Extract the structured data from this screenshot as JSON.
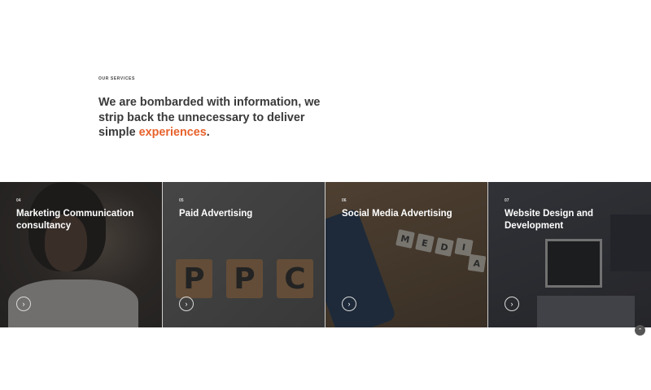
{
  "section": {
    "eyebrow": "OUR SERVICES",
    "headline_main": "We are bombarded with information, we strip back the unnecessary to deliver simple ",
    "headline_accent": "experiences",
    "headline_end": ".",
    "accent_color": "#e8622c"
  },
  "services": [
    {
      "number": "04",
      "title": "Marketing Communication consultancy",
      "icon": "chevron-right-icon"
    },
    {
      "number": "05",
      "title": "Paid Advertising",
      "icon": "chevron-right-icon"
    },
    {
      "number": "06",
      "title": "Social Media Advertising",
      "icon": "chevron-right-icon"
    },
    {
      "number": "07",
      "title": "Website Design and Development",
      "icon": "chevron-right-icon"
    }
  ],
  "images": {
    "ppc_letters": [
      "P",
      "P",
      "C"
    ],
    "social_tiles": [
      "M",
      "E",
      "D",
      "I",
      "A"
    ]
  },
  "scroll_top": {
    "icon": "chevron-up-icon"
  }
}
